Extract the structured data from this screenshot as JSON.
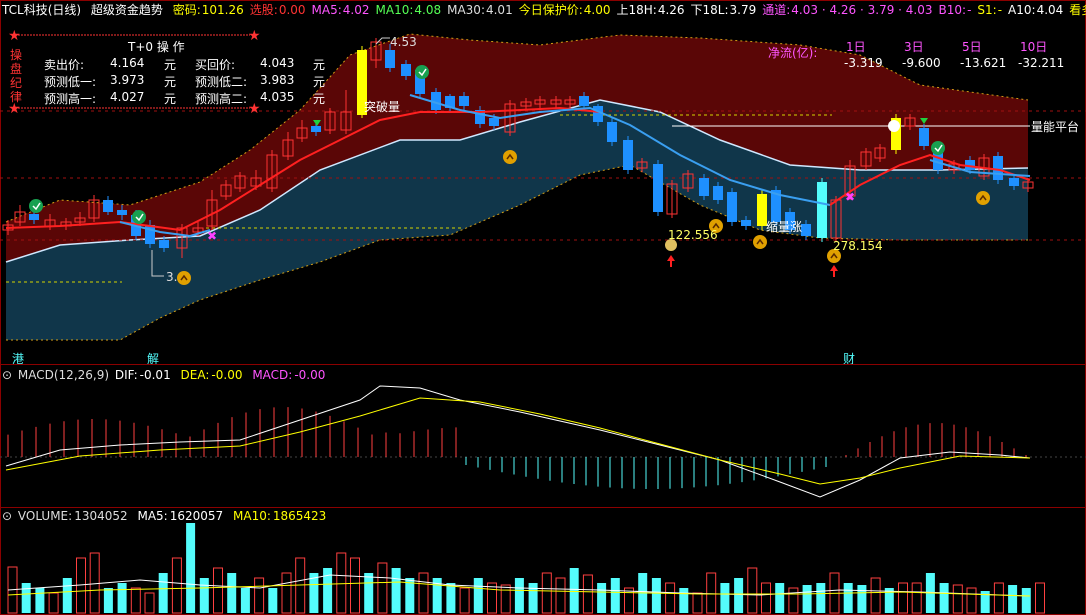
{
  "main_header": {
    "title": "TCL科技(日线)",
    "indicator": "超级资金趋势",
    "items": [
      {
        "label": "密码:",
        "value": "101.26",
        "color": "#ffff00"
      },
      {
        "label": "选股:",
        "value": "0.00",
        "color": "#ff3333"
      },
      {
        "label": "MA5:",
        "value": "4.02",
        "color": "#ff55ff"
      },
      {
        "label": "MA10:",
        "value": "4.08",
        "color": "#55ff55"
      },
      {
        "label": "MA30:",
        "value": "4.01",
        "color": "#dddddd"
      },
      {
        "label": "今日保护价:",
        "value": "4.00",
        "color": "#ffff00"
      },
      {
        "label": "上18H:",
        "value": "4.26",
        "color": "#ffffff"
      },
      {
        "label": "下18L:",
        "value": "3.79",
        "color": "#ffffff"
      },
      {
        "label": "通道:",
        "value": "4.03 · 4.26 · 3.79 · 4.03",
        "color": "#ff55ff"
      },
      {
        "label": "B10:",
        "value": "-",
        "color": "#ff55ff"
      },
      {
        "label": "S1:",
        "value": "-",
        "color": "#ffff00"
      },
      {
        "label": "A10:",
        "value": "4.04",
        "color": "#ffffff"
      },
      {
        "label": "看多:",
        "value": "◇",
        "color": "#ffff00"
      }
    ]
  },
  "ops_panel": {
    "title": "T+0 操 作",
    "side": "操盘纪律",
    "rows": [
      {
        "l1": "卖出价:",
        "v1": "4.164",
        "u1": "元",
        "l2": "买回价:",
        "v2": "4.043",
        "u2": "元"
      },
      {
        "l1": "预测低一:",
        "v1": "3.973",
        "u1": "元",
        "l2": "预测低二:",
        "v2": "3.983",
        "u2": "元"
      },
      {
        "l1": "预测高一:",
        "v1": "4.027",
        "u1": "元",
        "l2": "预测高二:",
        "v2": "4.035",
        "u2": "元"
      }
    ]
  },
  "net_flow": {
    "label": "净流(亿):",
    "periods": [
      "1日",
      "3日",
      "5日",
      "10日"
    ],
    "values": [
      "-3.319",
      "-9.600",
      "-13.621",
      "-32.211"
    ]
  },
  "annotations": {
    "breakout": "突破量",
    "shrink": "缩量涨",
    "platform": "量能平台",
    "price_top": "4.53",
    "price_low": "3.",
    "vol1": "122.556",
    "vol2": "278.154",
    "marker_gang": "港",
    "marker_jie": "解",
    "marker_cai": "财"
  },
  "macd_header": {
    "name": "MACD(12,26,9)",
    "dif_label": "DIF:",
    "dif": "-0.01",
    "dea_label": "DEA:",
    "dea": "-0.00",
    "macd_label": "MACD:",
    "macd": "-0.00"
  },
  "volume_header": {
    "name": "VOLUME:",
    "vol": "1304052",
    "ma5_label": "MA5:",
    "ma5": "1620057",
    "ma10_label": "MA10:",
    "ma10": "1865423"
  },
  "colors": {
    "up": "#ff3333",
    "down": "#54fcfc",
    "blue_down": "#1e90ff",
    "gold": "#ffff00",
    "magenta": "#ff55ff",
    "frame": "#8b0000"
  }
}
